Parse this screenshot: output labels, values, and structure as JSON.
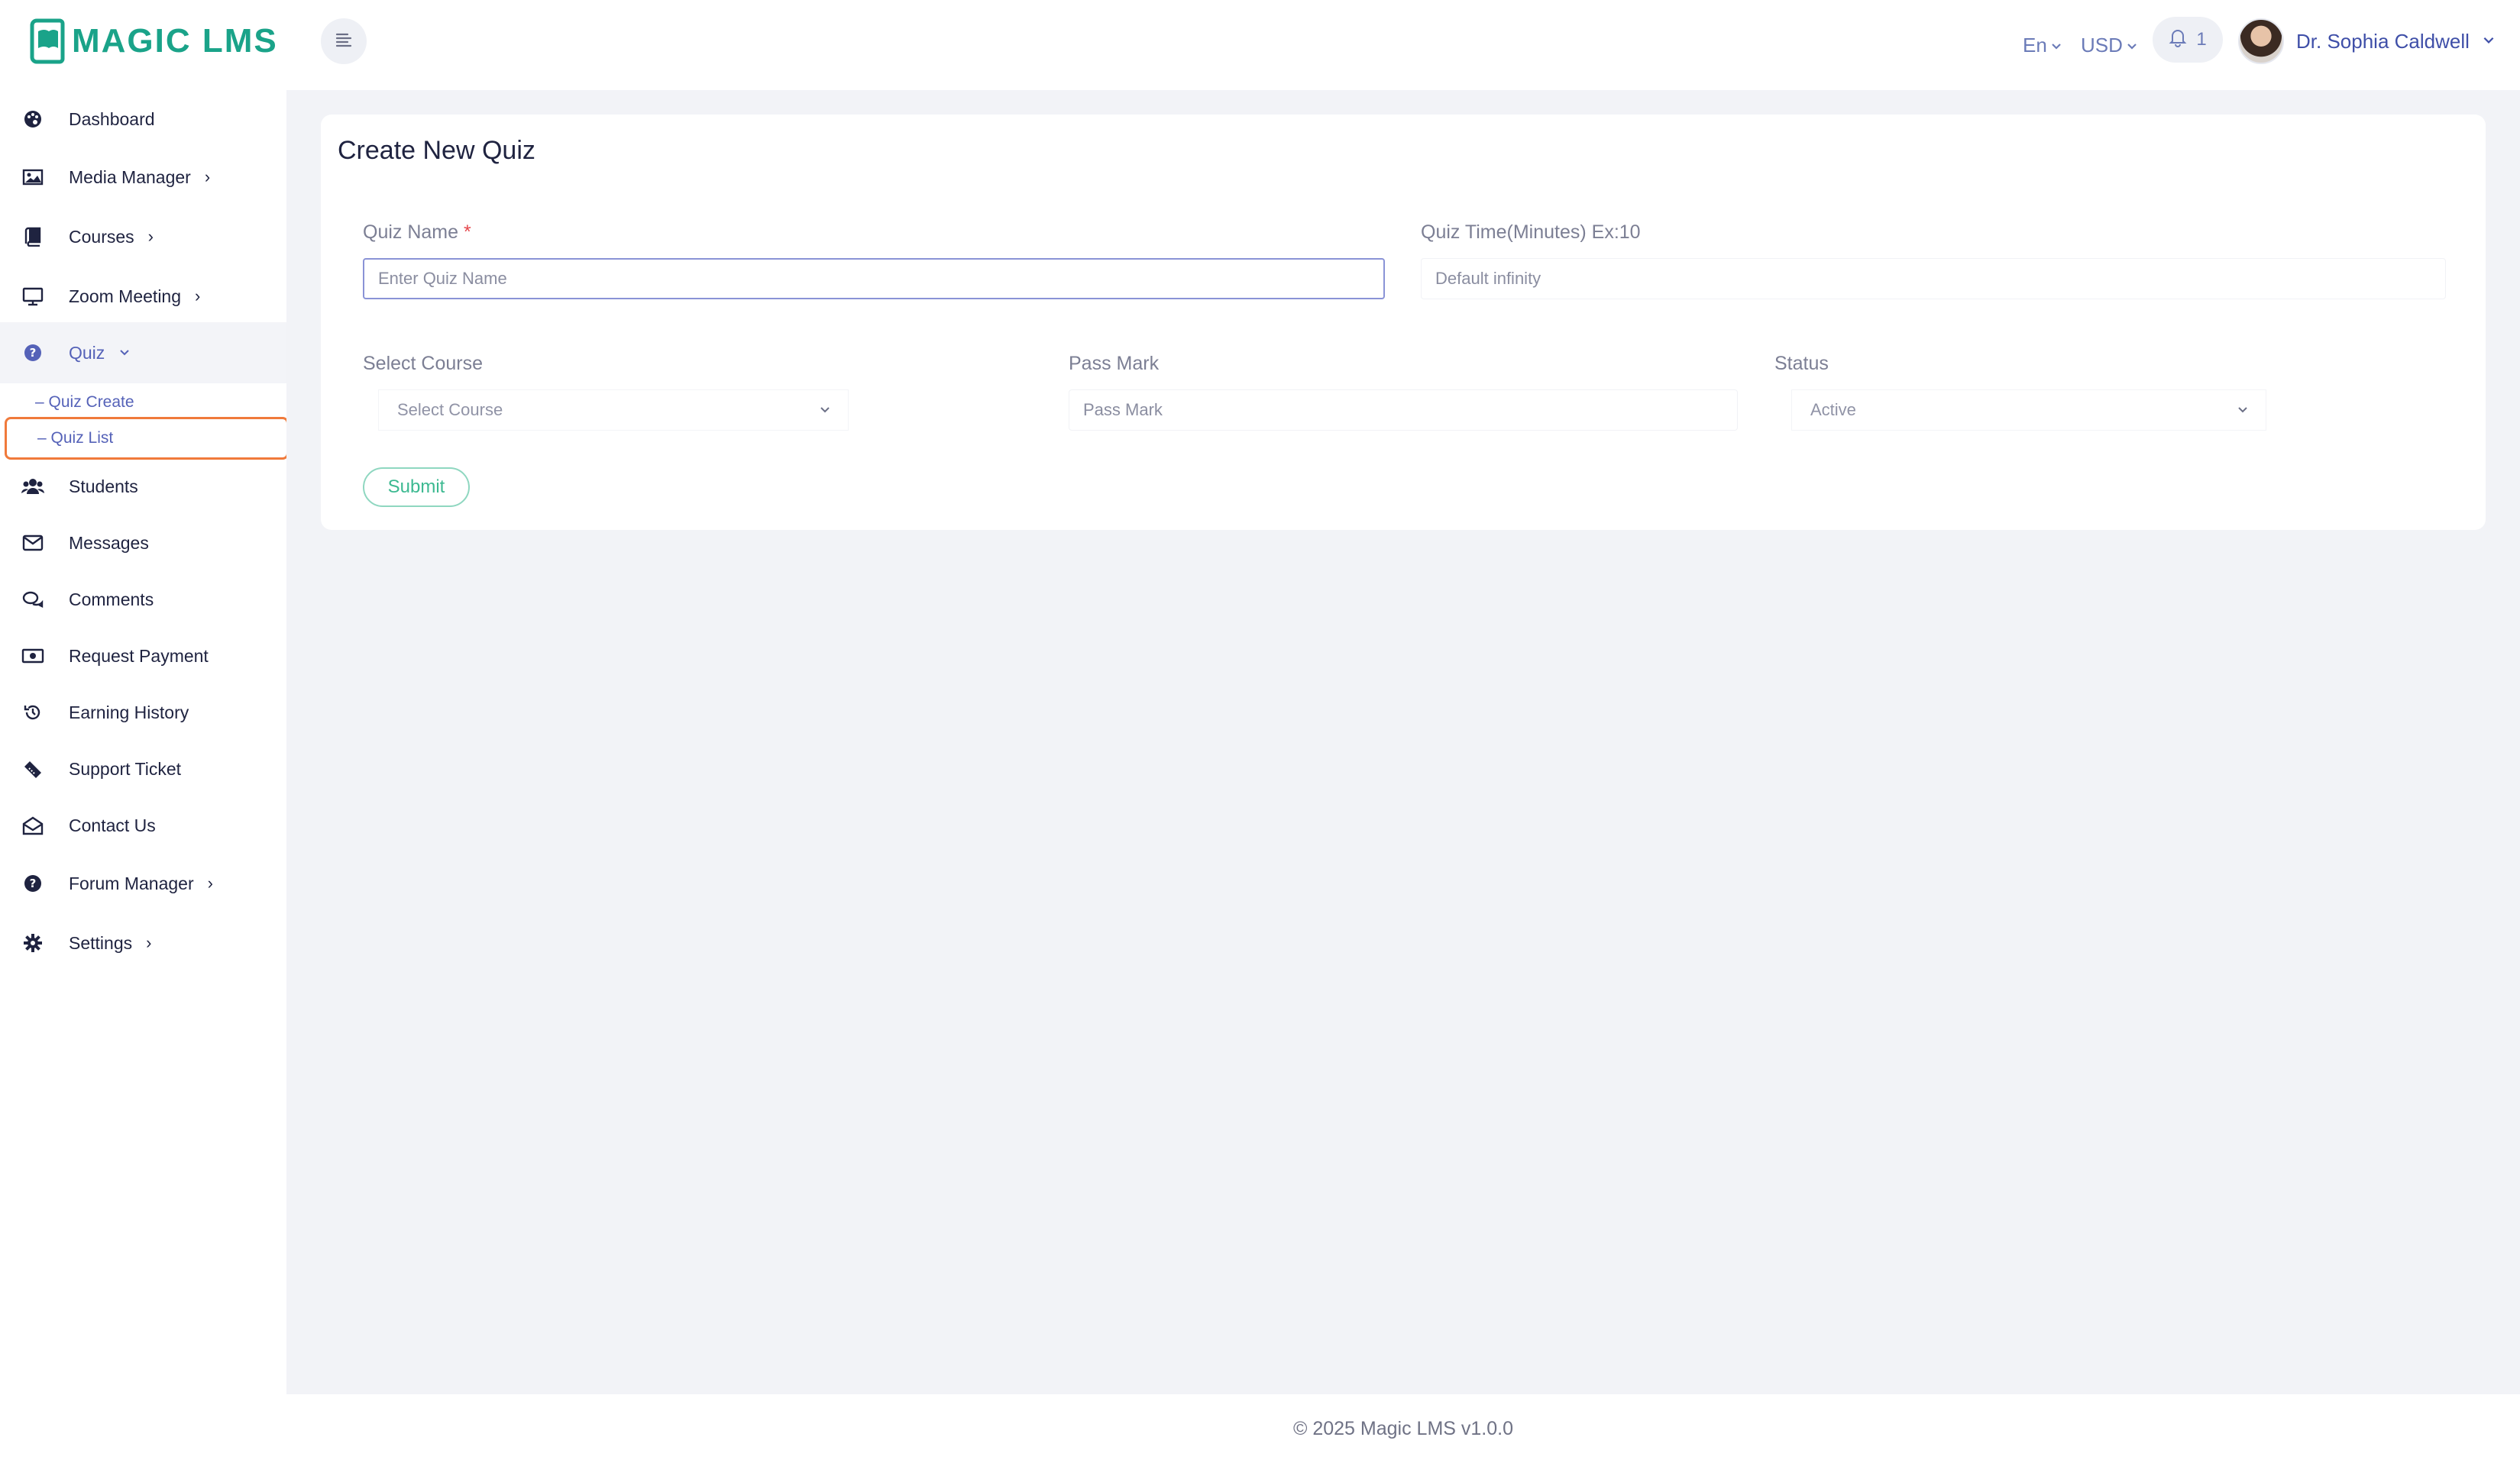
{
  "brand": {
    "name": "MAGIC LMS",
    "accent": "#1aa389"
  },
  "header": {
    "language": "En",
    "currency": "USD",
    "notification_count": "1",
    "user_name": "Dr. Sophia Caldwell"
  },
  "sidebar": {
    "items": [
      {
        "label": "Dashboard",
        "icon": "palette-icon"
      },
      {
        "label": "Media Manager",
        "icon": "image-icon"
      },
      {
        "label": "Courses",
        "icon": "book-icon"
      },
      {
        "label": "Zoom Meeting",
        "icon": "monitor-icon"
      },
      {
        "label": "Quiz",
        "icon": "question-circle-icon"
      },
      {
        "label": "Students",
        "icon": "users-icon"
      },
      {
        "label": "Messages",
        "icon": "envelope-icon"
      },
      {
        "label": "Comments",
        "icon": "comments-icon"
      },
      {
        "label": "Request Payment",
        "icon": "money-bill-icon"
      },
      {
        "label": "Earning History",
        "icon": "history-icon"
      },
      {
        "label": "Support Ticket",
        "icon": "ticket-icon"
      },
      {
        "label": "Contact Us",
        "icon": "envelope-open-icon"
      },
      {
        "label": "Forum Manager",
        "icon": "question-circle-icon"
      },
      {
        "label": "Settings",
        "icon": "gear-icon"
      }
    ],
    "quiz_sub": [
      "– Quiz Create",
      "– Quiz List"
    ]
  },
  "form": {
    "title": "Create New Quiz",
    "quiz_name_label": "Quiz Name",
    "required_mark": "*",
    "quiz_name_placeholder": "Enter Quiz Name",
    "quiz_time_label": "Quiz Time(Minutes) Ex:10",
    "quiz_time_placeholder": "Default infinity",
    "course_label": "Select Course",
    "course_value": "Select Course",
    "pass_mark_label": "Pass Mark",
    "pass_mark_placeholder": "Pass Mark",
    "status_label": "Status",
    "status_value": "Active",
    "submit_label": "Submit"
  },
  "footer": {
    "text": "© 2025 Magic LMS v1.0.0"
  }
}
